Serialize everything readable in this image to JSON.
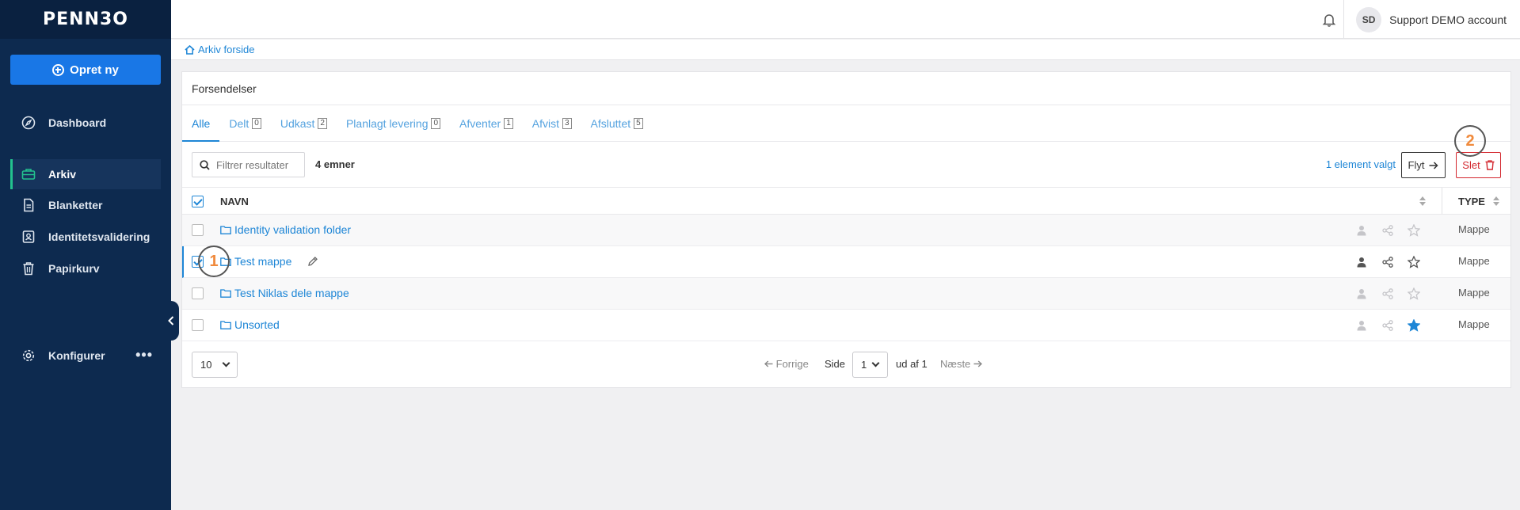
{
  "sidebar": {
    "logo": "PENN3O",
    "create_label": "Opret ny",
    "items": [
      {
        "label": "Dashboard"
      },
      {
        "label": "Arkiv"
      },
      {
        "label": "Blanketter"
      },
      {
        "label": "Identitetsvalidering"
      },
      {
        "label": "Papirkurv"
      },
      {
        "label": "Konfigurer"
      }
    ],
    "more": "•••"
  },
  "topbar": {
    "avatar_initials": "SD",
    "account_name": "Support DEMO account"
  },
  "breadcrumb": {
    "label": "Arkiv forside"
  },
  "card": {
    "title": "Forsendelser",
    "tabs": [
      {
        "label": "Alle",
        "count": ""
      },
      {
        "label": "Delt",
        "count": "0"
      },
      {
        "label": "Udkast",
        "count": "2"
      },
      {
        "label": "Planlagt levering",
        "count": "0"
      },
      {
        "label": "Afventer",
        "count": "1"
      },
      {
        "label": "Afvist",
        "count": "3"
      },
      {
        "label": "Afsluttet",
        "count": "5"
      }
    ],
    "filter_placeholder": "Filtrer resultater",
    "item_count": "4 emner",
    "selected_label": "1 element valgt",
    "move_label": "Flyt",
    "delete_label": "Slet",
    "columns": {
      "name": "NAVN",
      "type": "TYPE"
    },
    "rows": [
      {
        "name": "Identity validation folder",
        "type": "Mappe"
      },
      {
        "name": "Test mappe",
        "type": "Mappe"
      },
      {
        "name": "Test Niklas dele mappe",
        "type": "Mappe"
      },
      {
        "name": "Unsorted",
        "type": "Mappe"
      }
    ],
    "pager": {
      "page_size": "10",
      "prev": "Forrige",
      "page_label": "Side",
      "page": "1",
      "of": "ud af 1",
      "next": "Næste"
    }
  },
  "markers": [
    "1",
    "2"
  ],
  "colors": {
    "sidebar": "#0d2a4f",
    "primary": "#1977e6",
    "link": "#1e86d6",
    "danger": "#d3272e",
    "active_accent": "#23c28e",
    "marker": "#f08a3c"
  }
}
